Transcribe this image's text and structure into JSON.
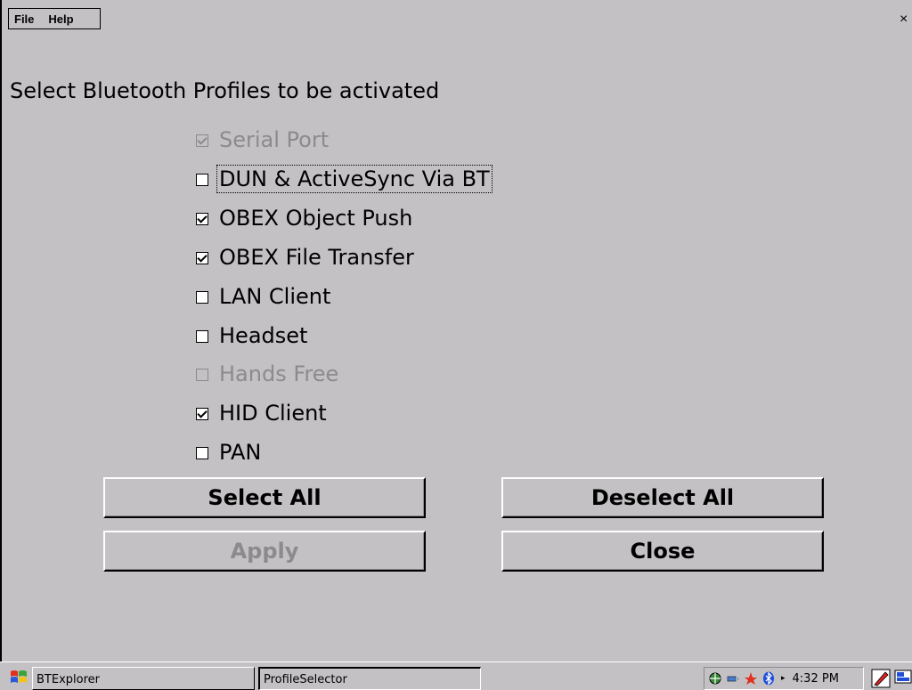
{
  "menu": {
    "file": "File",
    "help": "Help"
  },
  "window": {
    "close_glyph": "×"
  },
  "heading": "Select Bluetooth Profiles to be activated",
  "profiles": [
    {
      "label": "Serial Port",
      "checked": true,
      "enabled": false
    },
    {
      "label": "DUN & ActiveSync Via BT",
      "checked": false,
      "enabled": true,
      "focused": true
    },
    {
      "label": "OBEX Object Push",
      "checked": true,
      "enabled": true
    },
    {
      "label": "OBEX File Transfer",
      "checked": true,
      "enabled": true
    },
    {
      "label": "LAN Client",
      "checked": false,
      "enabled": true
    },
    {
      "label": "Headset",
      "checked": false,
      "enabled": true
    },
    {
      "label": "Hands Free",
      "checked": false,
      "enabled": false
    },
    {
      "label": "HID Client",
      "checked": true,
      "enabled": true
    },
    {
      "label": "PAN",
      "checked": false,
      "enabled": true
    }
  ],
  "buttons": {
    "select_all": "Select All",
    "deselect_all": "Deselect All",
    "apply": "Apply",
    "close": "Close"
  },
  "taskbar": {
    "tasks": [
      "BTExplorer",
      "ProfileSelector"
    ],
    "tray_arrow": "▸",
    "time": "4:32 PM",
    "icons": [
      "network-icon",
      "usb-icon",
      "flash-icon",
      "bluetooth-icon",
      "pen-icon",
      "desktop-icon"
    ]
  },
  "colors": {
    "background": "#c4c1c4",
    "disabled_text": "#8c8a8c",
    "bluetooth": "#1f4fd6"
  }
}
